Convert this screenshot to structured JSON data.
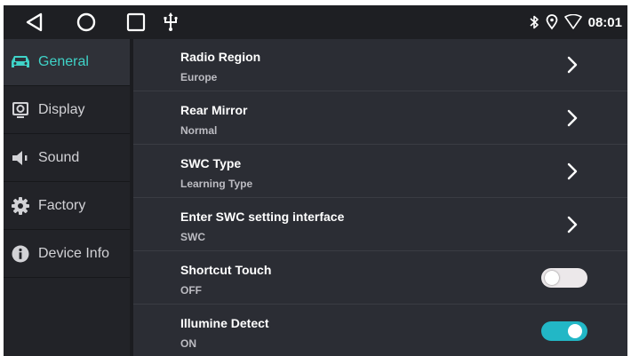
{
  "status_bar": {
    "time": "08:01",
    "nav_icons": [
      "back-icon",
      "home-icon",
      "recents-icon",
      "usb-icon"
    ],
    "status_icons": [
      "bluetooth-icon",
      "location-icon",
      "wifi-icon"
    ]
  },
  "sidebar": {
    "items": [
      {
        "label": "General",
        "icon": "car-icon",
        "active": true
      },
      {
        "label": "Display",
        "icon": "display-icon",
        "active": false
      },
      {
        "label": "Sound",
        "icon": "speaker-icon",
        "active": false
      },
      {
        "label": "Factory",
        "icon": "gear-icon",
        "active": false
      },
      {
        "label": "Device Info",
        "icon": "info-icon",
        "active": false
      }
    ]
  },
  "settings": {
    "rows": [
      {
        "title": "Radio Region",
        "value": "Europe",
        "control": "chevron"
      },
      {
        "title": "Rear Mirror",
        "value": "Normal",
        "control": "chevron"
      },
      {
        "title": "SWC Type",
        "value": "Learning Type",
        "control": "chevron"
      },
      {
        "title": "Enter SWC setting interface",
        "value": "SWC",
        "control": "chevron"
      },
      {
        "title": "Shortcut Touch",
        "value": "OFF",
        "control": "toggle",
        "on": false
      },
      {
        "title": "Illumine Detect",
        "value": "ON",
        "control": "toggle",
        "on": true
      }
    ]
  },
  "colors": {
    "accent": "#3fd3c8",
    "toggle_on": "#22b7c6",
    "background": "#2b2d34",
    "sidebar": "#222328",
    "status_bar": "#1e1f23"
  }
}
